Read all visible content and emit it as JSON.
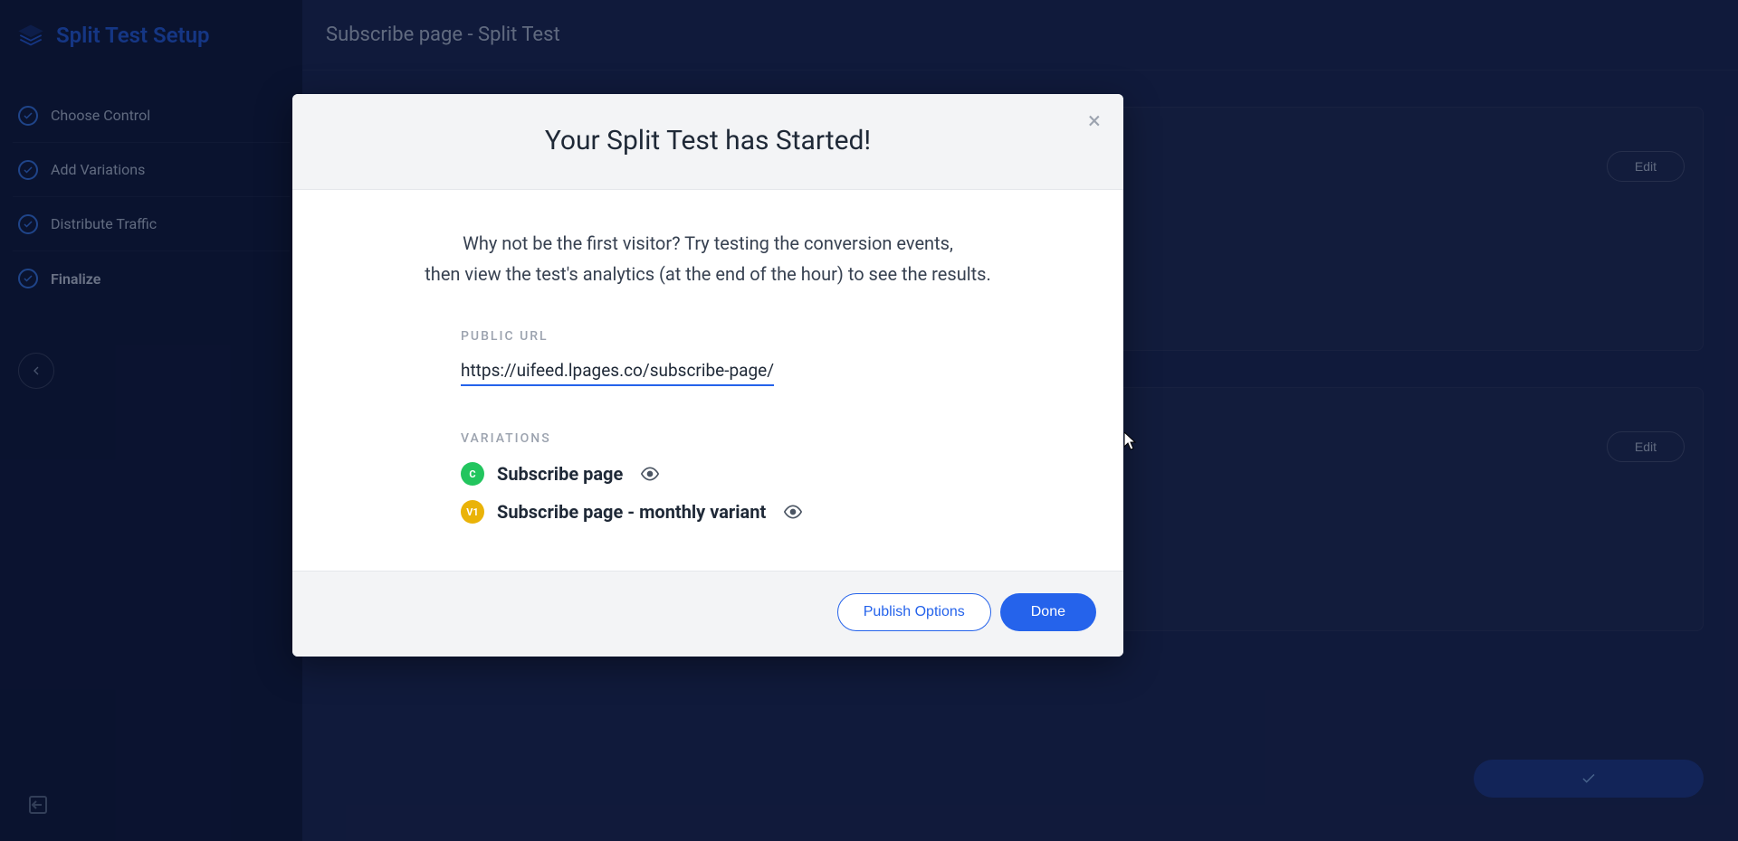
{
  "sidebar": {
    "title": "Split Test Setup",
    "steps": [
      {
        "label": "Choose Control",
        "active": false
      },
      {
        "label": "Add Variations",
        "active": false
      },
      {
        "label": "Distribute Traffic",
        "active": false
      },
      {
        "label": "Finalize",
        "active": true
      }
    ]
  },
  "main": {
    "page_title": "Subscribe page - Split Test",
    "edit_label": "Edit"
  },
  "modal": {
    "title": "Your Split Test has Started!",
    "description_line1": "Why not be the first visitor? Try testing the conversion events,",
    "description_line2": "then view the test's analytics (at the end of the hour) to see the results.",
    "public_url_label": "PUBLIC URL",
    "public_url": "https://uifeed.lpages.co/subscribe-page/",
    "variations_label": "VARIATIONS",
    "variations": [
      {
        "badge": "C",
        "badge_class": "badge-c",
        "name": "Subscribe page"
      },
      {
        "badge": "V1",
        "badge_class": "badge-v1",
        "name": "Subscribe page - monthly variant"
      }
    ],
    "publish_options_label": "Publish Options",
    "done_label": "Done"
  }
}
